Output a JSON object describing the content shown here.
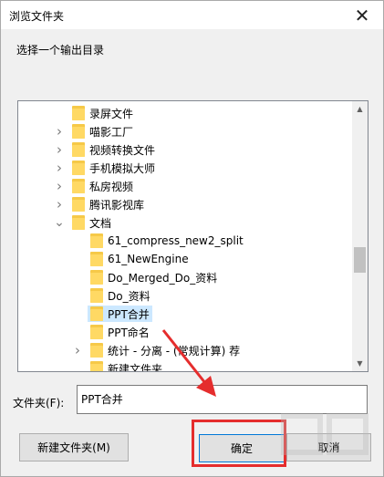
{
  "dialog": {
    "title": "浏览文件夹",
    "close_glyph": "✕",
    "prompt": "选择一个输出目录"
  },
  "tree": {
    "items": [
      {
        "label": "录屏文件",
        "level": 1,
        "expander": "none"
      },
      {
        "label": "喵影工厂",
        "level": 1,
        "expander": "collapsed"
      },
      {
        "label": "视频转换文件",
        "level": 1,
        "expander": "collapsed"
      },
      {
        "label": "手机模拟大师",
        "level": 1,
        "expander": "collapsed"
      },
      {
        "label": "私房视频",
        "level": 1,
        "expander": "collapsed"
      },
      {
        "label": "腾讯影视库",
        "level": 1,
        "expander": "collapsed"
      },
      {
        "label": "文档",
        "level": 1,
        "expander": "expanded"
      },
      {
        "label": "61_compress_new2_split",
        "level": 2,
        "expander": "none"
      },
      {
        "label": "61_NewEngine",
        "level": 2,
        "expander": "none"
      },
      {
        "label": "Do_Merged_Do_资料",
        "level": 2,
        "expander": "none"
      },
      {
        "label": "Do_资料",
        "level": 2,
        "expander": "none"
      },
      {
        "label": "PPT合并",
        "level": 2,
        "expander": "none",
        "selected": true
      },
      {
        "label": "PPT命名",
        "level": 2,
        "expander": "none"
      },
      {
        "label": "统计 - 分离 - (常规计算) 荐",
        "level": 2,
        "expander": "collapsed"
      },
      {
        "label": "新建文件夹",
        "level": 2,
        "expander": "none"
      }
    ]
  },
  "folder_field": {
    "label": "文件夹(F):",
    "value": "PPT合并"
  },
  "buttons": {
    "new_folder": "新建文件夹(M)",
    "ok": "确定",
    "cancel": "取消"
  },
  "colors": {
    "annotation_red": "#e52d2d",
    "selection_bg": "#cce8ff",
    "folder_yellow": "#ffd964"
  }
}
